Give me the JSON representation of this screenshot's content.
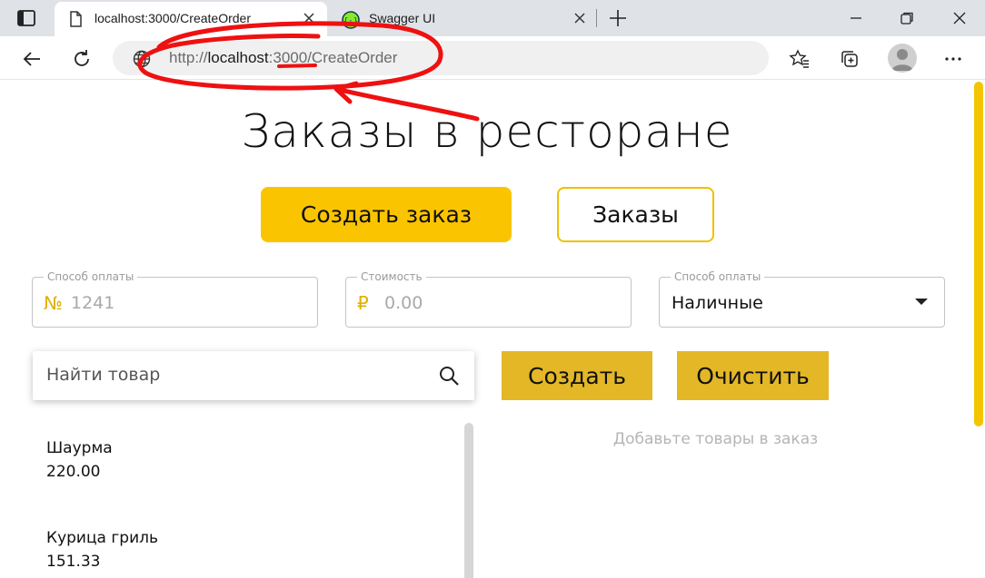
{
  "browser": {
    "tabs": [
      {
        "title": "localhost:3000/CreateOrder",
        "active": true,
        "icon": "page-icon"
      },
      {
        "title": "Swagger UI",
        "active": false,
        "icon": "swagger-icon"
      }
    ],
    "url": {
      "prefix": "http://",
      "host": "localhost",
      "colon": ":",
      "port": "3000",
      "path": "/CreateOrder"
    }
  },
  "page": {
    "title": "Заказы в ресторане",
    "nav": {
      "create_order": "Создать заказ",
      "orders": "Заказы"
    },
    "fields": {
      "order_number": {
        "label": "Способ оплаты",
        "prefix": "№",
        "placeholder": "1241"
      },
      "cost": {
        "label": "Стоимость",
        "prefix": "₽",
        "placeholder": "0.00"
      },
      "payment": {
        "label": "Способ оплаты",
        "value": "Наличные"
      }
    },
    "search": {
      "placeholder": "Найти товар"
    },
    "actions": {
      "create": "Создать",
      "clear": "Очистить"
    },
    "empty_message": "Добавьте товары в заказ",
    "products": [
      {
        "name": "Шаурма",
        "price": "220.00"
      },
      {
        "name": "Курица гриль",
        "price": "151.33"
      }
    ]
  },
  "colors": {
    "accent": "#fbc400",
    "button": "#e3b726",
    "annotation": "#ee1111"
  }
}
